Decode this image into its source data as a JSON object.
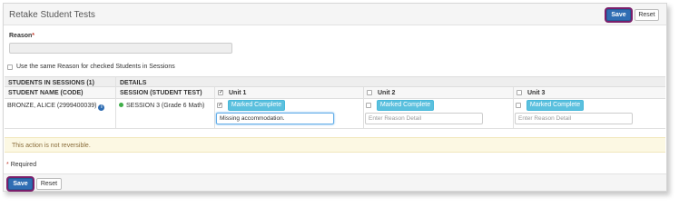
{
  "header": {
    "title": "Retake Student Tests",
    "save_label": "Save",
    "reset_label": "Reset"
  },
  "form": {
    "reason_label": "Reason",
    "required_marker": "*",
    "reason_value": "",
    "same_reason_label": "Use the same Reason for checked Students in Sessions",
    "same_reason_checked": false
  },
  "table": {
    "group_headers": [
      "STUDENTS IN SESSIONS (1)",
      "DETAILS"
    ],
    "col_student": "STUDENT NAME (CODE)",
    "col_session": "SESSION (STUDENT TEST)",
    "units": [
      {
        "label": "Unit 1",
        "checked": true
      },
      {
        "label": "Unit 2",
        "checked": false
      },
      {
        "label": "Unit 3",
        "checked": false
      }
    ],
    "rows": [
      {
        "student": "BRONZE, ALICE (2999400039)",
        "session": "SESSION 3 (Grade 6 Math)",
        "session_status_color": "#3fae49",
        "units": [
          {
            "checked": true,
            "button": "Marked Complete",
            "detail_value": "Missing accommodation.",
            "detail_placeholder": "Enter Reason Detail"
          },
          {
            "checked": false,
            "button": "Marked Complete",
            "detail_value": "",
            "detail_placeholder": "Enter Reason Detail"
          },
          {
            "checked": false,
            "button": "Marked Complete",
            "detail_value": "",
            "detail_placeholder": "Enter Reason Detail"
          }
        ]
      }
    ]
  },
  "warning": "This action is not reversible.",
  "required_note": "Required",
  "footer": {
    "save_label": "Save",
    "reset_label": "Reset"
  },
  "icons": {
    "info": "info-icon",
    "check": "checkmark",
    "status": "status-dot-icon"
  },
  "colors": {
    "primary": "#2f6db3",
    "info": "#5bc0de",
    "warning_bg": "#fcf8e3",
    "warning_text": "#8a6d3b",
    "status_green": "#3fae49"
  }
}
